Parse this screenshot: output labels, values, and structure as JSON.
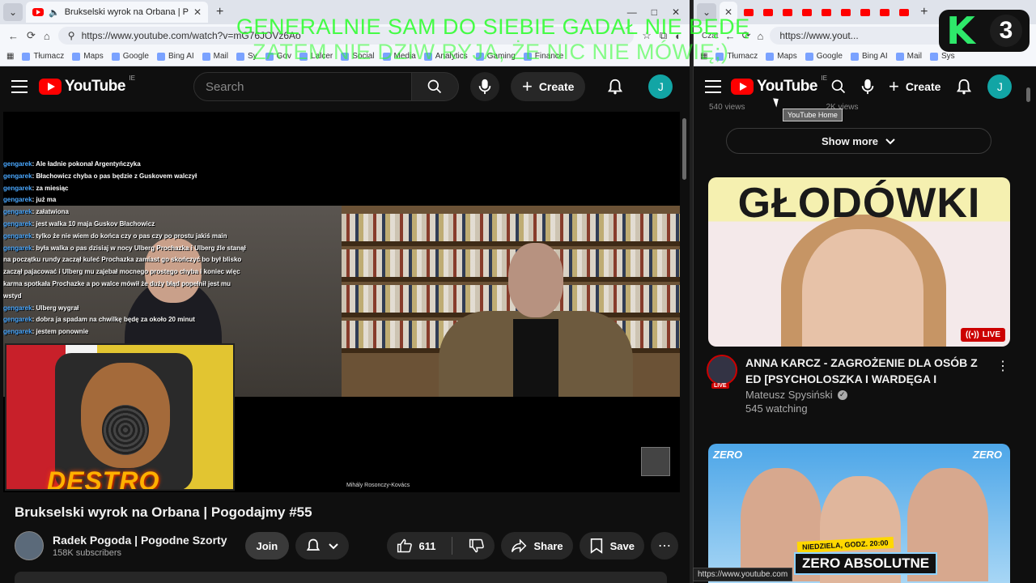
{
  "left_browser": {
    "tab_title": "Brukselski wyrok na Orbana | P",
    "url": "https://www.youtube.com/watch?v=mG76JOVz6Ao",
    "bookmarks": [
      "Tłumacz",
      "Maps",
      "Google",
      "Bing AI",
      "Mail",
      "Sy",
      "Gov",
      "Lalcer",
      "Social",
      "Media",
      "Analytics",
      "Gaming",
      "Finance"
    ],
    "window_controls": [
      "—",
      "□",
      "✕"
    ]
  },
  "right_browser": {
    "url": "https://www.yout...",
    "bookmarks": [
      "Tłumacz",
      "Maps",
      "Google",
      "Bing AI",
      "Mail",
      "Sys"
    ],
    "bookmark_left_label": "Czat"
  },
  "youtube": {
    "logo_text": "YouTube",
    "country_code": "IE",
    "search_placeholder": "Search",
    "create_label": "Create",
    "avatar_letter": "J",
    "tooltip": "YouTube Home"
  },
  "video": {
    "title": "Brukselski wyrok na Orbana | Pogodajmy #55",
    "channel_name": "Radek Pogoda | Pogodne Szorty",
    "subscribers": "158K subscribers",
    "join_label": "Join",
    "likes": "611",
    "share_label": "Share",
    "save_label": "Save",
    "guest_caption": "Mihály Rosonczy-Kovács",
    "cam_logo": "DESTRO"
  },
  "chat": [
    {
      "nick": "gengarek",
      "text": ": Ale ładnie pokonał Argentyńczyka"
    },
    {
      "nick": "gengarek",
      "text": ": Błachowicz chyba o pas będzie z Guskovem walczył"
    },
    {
      "nick": "gengarek",
      "text": ": za miesiąc"
    },
    {
      "nick": "gengarek",
      "text": ": już ma"
    },
    {
      "nick": "gengarek",
      "text": ": załatwiona"
    },
    {
      "nick": "gengarek",
      "text": ": jest walka 10 maja Guskov Błachowicz"
    },
    {
      "nick": "gengarek",
      "text": ": tylko że nie wiem do końca czy o pas czy po prostu jakiś main"
    },
    {
      "nick": "gengarek",
      "text": ": była walka o pas dzisiaj w nocy Ulberg Prochazka i Ulberg źle stanął na początku rundy zaczął kuleć Prochazka zamiast go skończyć bo był blisko zaczął pajacować i Ulberg mu zajebał mocnego prostego chyba i koniec więc karma spotkała Prochazke a po walce mówił że duży błąd popełnił jest mu wstyd"
    },
    {
      "nick": "gengarek",
      "text": ": Ulberg wygrał"
    },
    {
      "nick": "gengarek",
      "text": ": dobra ja spadam na chwilkę będę za około 20 minut"
    },
    {
      "nick": "gengarek",
      "text": ": jestem ponownie"
    }
  ],
  "sidebar": {
    "views_left": "540 views",
    "views_right": "2K views",
    "show_more": "Show more",
    "video1": {
      "thumb_text": "GŁODÓWKI",
      "live_badge": "LIVE",
      "avatar_live": "LIVE",
      "title": "ANNA KARCZ - ZAGROŻENIE DLA OSÓB Z ED [PSYCHOLOSZKA I WARDĘGA I BOYCZITEK I ...",
      "channel": "Mateusz Spysiński",
      "meta": "545 watching"
    },
    "video2": {
      "brand_left": "ZERO",
      "brand_right": "ZERO",
      "date_text": "NIEDZIELA, GODZ. 20:00",
      "show_title": "ZERO ABSOLUTNE"
    }
  },
  "overlay": {
    "line1": "GENERALNIE SAM DO SIEBIE GADAŁ NIE BĘDĘ",
    "line2": "ZATEM NIE DZIW RYJA, ŻE NIC NIE MÓWIĘ;)",
    "badge_letter": "K",
    "badge_number": "3"
  },
  "status_bar_url": "https://www.youtube.com",
  "colors": {
    "youtube_red": "#ff0000",
    "background": "#0f0f0f",
    "overlay_green": "#28ff28",
    "chat_nick": "#4aa8ff"
  }
}
